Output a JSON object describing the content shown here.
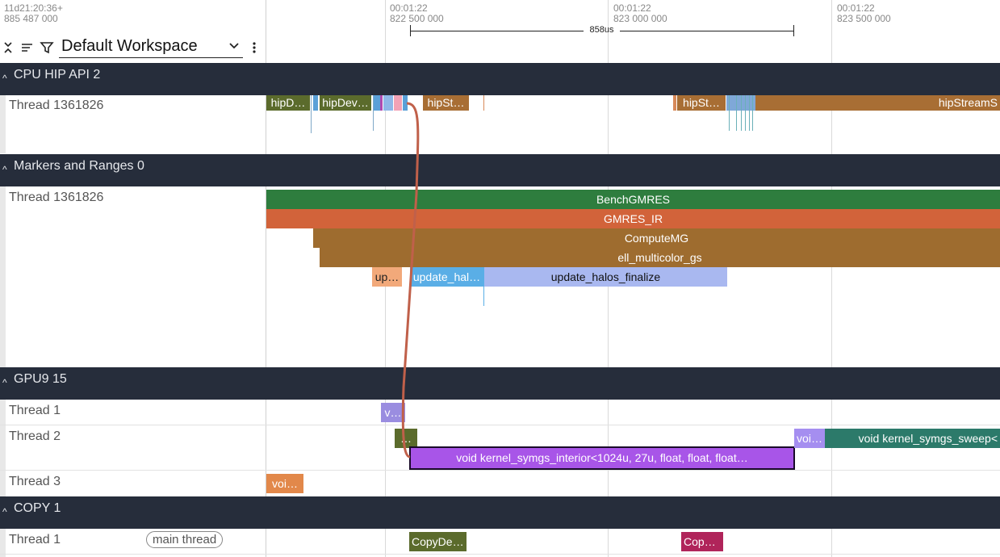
{
  "header": {
    "timestamp_top": "11d21:20:36+",
    "timestamp_sub": "885 487 000",
    "workspace": "Default Workspace",
    "ticks": [
      {
        "time": "00:01:22",
        "ns": "822 500 000"
      },
      {
        "time": "00:01:22",
        "ns": "823 000 000"
      },
      {
        "time": "00:01:22",
        "ns": "823 500 000"
      }
    ],
    "measure": "858us"
  },
  "sections": {
    "cpu": {
      "title": "CPU HIP API 2",
      "thread": "Thread 1361826"
    },
    "markers": {
      "title": "Markers and Ranges 0",
      "thread": "Thread 1361826"
    },
    "gpu": {
      "title": "GPU9 15",
      "thread1": "Thread 1",
      "thread2": "Thread 2",
      "thread3": "Thread 3"
    },
    "copy": {
      "title": "COPY 1",
      "thread1": "Thread 1",
      "main_thread": "main thread"
    }
  },
  "slices": {
    "cpu_1": "hipD…",
    "cpu_2": "hipDev…",
    "cpu_3": "hipSt…",
    "cpu_4": "hipSt…",
    "cpu_5": "hipStreamS",
    "m_bench": "BenchGMRES",
    "m_gmres": "GMRES_IR",
    "m_compute": "ComputeMG",
    "m_ell": "ell_multicolor_gs",
    "m_up": "up…",
    "m_update_hal": "update_hal…",
    "m_finalize": "update_halos_finalize",
    "g1_v": "v…",
    "g2_small": "…",
    "g2_interior": "void kernel_symgs_interior<1024u, 27u, float, float, float…",
    "g2_voi": "voi…",
    "g2_sweep": "void kernel_symgs_sweep<",
    "g3_voi": "voi…",
    "c_copydev": "CopyDev…",
    "c_copy": "Copy…"
  },
  "colors": {
    "section_bg": "#262d3b",
    "hip_olive": "#5b6b2c",
    "hip_brown": "#a86e34",
    "bench_green": "#2e7d3e",
    "gmres_orange": "#d2633a",
    "compute_brown": "#9e6c2f",
    "interior_purple": "#a855e8",
    "sweep_teal": "#2c7a6a",
    "flow_arrow": "#c0604a"
  }
}
